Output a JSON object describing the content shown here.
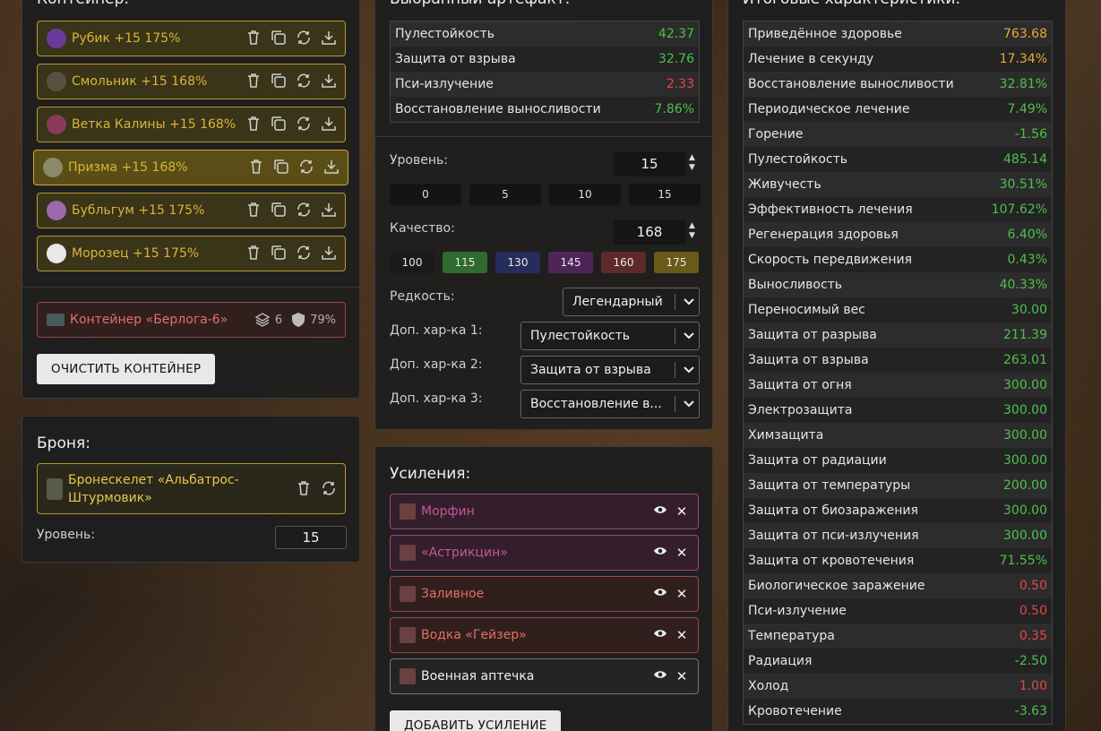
{
  "container": {
    "title": "Контейнер:",
    "items": [
      {
        "label": "Рубик +15 175%",
        "icon": "rubik-artifact-icon",
        "color": "#6a3a9a"
      },
      {
        "label": "Смольник +15 168%",
        "icon": "smolnik-artifact-icon",
        "color": "#5a5040"
      },
      {
        "label": "Ветка Калины +15 168%",
        "icon": "kalina-artifact-icon",
        "color": "#8a3a5a"
      },
      {
        "label": "Призма +15 168%",
        "icon": "prism-artifact-icon",
        "color": "#8a8a6a"
      },
      {
        "label": "Бубльгум +15 175%",
        "icon": "bubblegum-artifact-icon",
        "color": "#9a6aaa"
      },
      {
        "label": "Морозец +15 175%",
        "icon": "morozets-artifact-icon",
        "color": "#e8e8e8"
      }
    ],
    "container_name": "Контейнер «Берлога-6»",
    "slots": "6",
    "protection": "79%",
    "clear_button": "ОЧИСТИТЬ КОНТЕЙНЕР"
  },
  "armor": {
    "title": "Броня:",
    "name_line1": "Бронескелет «Альбатрос-",
    "name_line2": "Штурмовик»",
    "level_label": "Уровень:",
    "level_value": "15"
  },
  "artifact": {
    "title": "Выбранный артефакт:",
    "stats": [
      {
        "name": "Пулестойкость",
        "value": "42.37",
        "tone": "green"
      },
      {
        "name": "Защита от взрыва",
        "value": "32.76",
        "tone": "green"
      },
      {
        "name": "Пси-излучение",
        "value": "2.33",
        "tone": "red"
      },
      {
        "name": "Восстановление выносливости",
        "value": "7.86%",
        "tone": "green"
      }
    ],
    "level_label": "Уровень:",
    "level_value": "15",
    "level_presets": [
      "0",
      "5",
      "10",
      "15"
    ],
    "quality_label": "Качество:",
    "quality_value": "168",
    "quality_presets": [
      {
        "label": "100",
        "color": "#1a1a1a"
      },
      {
        "label": "115",
        "color": "#2f6a2f"
      },
      {
        "label": "130",
        "color": "#262c5e"
      },
      {
        "label": "145",
        "color": "#4e2558"
      },
      {
        "label": "160",
        "color": "#5e2a2a"
      },
      {
        "label": "175",
        "color": "#6a5a1a"
      }
    ],
    "rarity_label": "Редкость:",
    "rarity_value": "Легендарный",
    "extra1_label": "Доп. хар-ка 1:",
    "extra1_value": "Пулестойкость",
    "extra2_label": "Доп. хар-ка 2:",
    "extra2_value": "Защита от взрыва",
    "extra3_label": "Доп. хар-ка 3:",
    "extra3_value": "Восстановление в..."
  },
  "boosts": {
    "title": "Усиления:",
    "items": [
      {
        "label": "Морфин",
        "color": "#c05a9a",
        "border": "#9a4a7e",
        "bg": "rgba(70,30,55,0.55)"
      },
      {
        "label": "«Астрикцин»",
        "color": "#c05a9a",
        "border": "#9a4a7e",
        "bg": "rgba(70,30,55,0.55)"
      },
      {
        "label": "Заливное",
        "color": "#e07060",
        "border": "#9a4848",
        "bg": "rgba(70,30,30,0.45)"
      },
      {
        "label": "Водка «Гейзер»",
        "color": "#e07060",
        "border": "#9a4848",
        "bg": "rgba(70,30,30,0.45)"
      },
      {
        "label": "Военная аптечка",
        "color": "#f0f0f0",
        "border": "#777777",
        "bg": "rgba(40,40,40,0.6)"
      }
    ],
    "add_button": "ДОБАВИТЬ УСИЛЕНИЕ"
  },
  "totals": {
    "title": "Итоговые характеристики:",
    "rows": [
      {
        "name": "Приведённое здоровье",
        "value": "763.68",
        "tone": "orange"
      },
      {
        "name": "Лечение в секунду",
        "value": "17.34%",
        "tone": "orange"
      },
      {
        "name": "Восстановление выносливости",
        "value": "32.81%",
        "tone": "green"
      },
      {
        "name": "Периодическое лечение",
        "value": "7.49%",
        "tone": "green"
      },
      {
        "name": "Горение",
        "value": "-1.56",
        "tone": "green"
      },
      {
        "name": "Пулестойкость",
        "value": "485.14",
        "tone": "green"
      },
      {
        "name": "Живучесть",
        "value": "30.51%",
        "tone": "green"
      },
      {
        "name": "Эффективность лечения",
        "value": "107.62%",
        "tone": "green"
      },
      {
        "name": "Регенерация здоровья",
        "value": "6.40%",
        "tone": "green"
      },
      {
        "name": "Скорость передвижения",
        "value": "0.43%",
        "tone": "green"
      },
      {
        "name": "Выносливость",
        "value": "40.33%",
        "tone": "green"
      },
      {
        "name": "Переносимый вес",
        "value": "30.00",
        "tone": "green"
      },
      {
        "name": "Защита от разрыва",
        "value": "211.39",
        "tone": "green"
      },
      {
        "name": "Защита от взрыва",
        "value": "263.01",
        "tone": "green"
      },
      {
        "name": "Защита от огня",
        "value": "300.00",
        "tone": "green"
      },
      {
        "name": "Электрозащита",
        "value": "300.00",
        "tone": "green"
      },
      {
        "name": "Химзащита",
        "value": "300.00",
        "tone": "green"
      },
      {
        "name": "Защита от радиации",
        "value": "300.00",
        "tone": "green"
      },
      {
        "name": "Защита от температуры",
        "value": "200.00",
        "tone": "green"
      },
      {
        "name": "Защита от биозаражения",
        "value": "300.00",
        "tone": "green"
      },
      {
        "name": "Защита от пси-излучения",
        "value": "300.00",
        "tone": "green"
      },
      {
        "name": "Защита от кровотечения",
        "value": "71.55%",
        "tone": "green"
      },
      {
        "name": "Биологическое заражение",
        "value": "0.50",
        "tone": "red"
      },
      {
        "name": "Пси-излучение",
        "value": "0.50",
        "tone": "red"
      },
      {
        "name": "Температура",
        "value": "0.35",
        "tone": "red"
      },
      {
        "name": "Радиация",
        "value": "-2.50",
        "tone": "green"
      },
      {
        "name": "Холод",
        "value": "1.00",
        "tone": "red"
      },
      {
        "name": "Кровотечение",
        "value": "-3.63",
        "tone": "green"
      }
    ]
  }
}
